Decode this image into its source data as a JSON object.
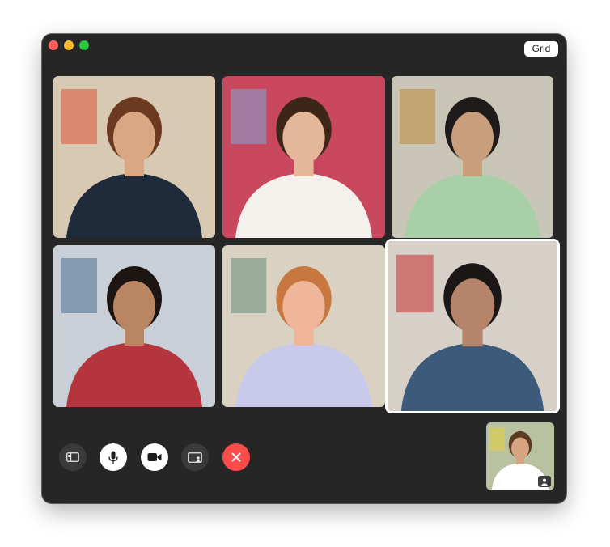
{
  "window": {
    "grid_button_label": "Grid"
  },
  "participants": [
    {
      "label": "participant-1",
      "background": "#d8c9b3",
      "skin": "#d9a783",
      "hair": "#6b3a21",
      "clothing": "#1f2a3a",
      "accent": "#e0523b"
    },
    {
      "label": "participant-2",
      "background": "#c9485e",
      "skin": "#e5b79a",
      "hair": "#3d2618",
      "clothing": "#f4f1ec",
      "accent": "#7fa6d8"
    },
    {
      "label": "participant-3",
      "background": "#c9c6b8",
      "skin": "#c99e7b",
      "hair": "#1e1b1a",
      "clothing": "#a9cfa9",
      "accent": "#b98b3a"
    },
    {
      "label": "participant-4",
      "background": "#c8cfd6",
      "skin": "#b98563",
      "hair": "#1c1512",
      "clothing": "#b5353f",
      "accent": "#4a6f94"
    },
    {
      "label": "participant-5",
      "background": "#d9d2c2",
      "skin": "#f0b69a",
      "hair": "#c7773f",
      "clothing": "#c9c9ec",
      "accent": "#6a8c7a"
    },
    {
      "label": "participant-6",
      "background": "#d7d0c9",
      "skin": "#b5846a",
      "hair": "#1a1716",
      "clothing": "#3d5a7a",
      "accent": "#c6302f"
    }
  ],
  "self_view": {
    "background": "#b9c2a0",
    "skin": "#d6a482",
    "hair": "#5b3a22",
    "clothing": "#ffffff",
    "accent": "#e6d23a"
  },
  "controls": {
    "sidebar_icon": "sidebar-icon",
    "microphone_icon": "microphone-icon",
    "camera_icon": "video-camera-icon",
    "share_screen_icon": "share-screen-icon",
    "end_call_icon": "close-icon",
    "end_call_color": "#fa4c4a"
  }
}
